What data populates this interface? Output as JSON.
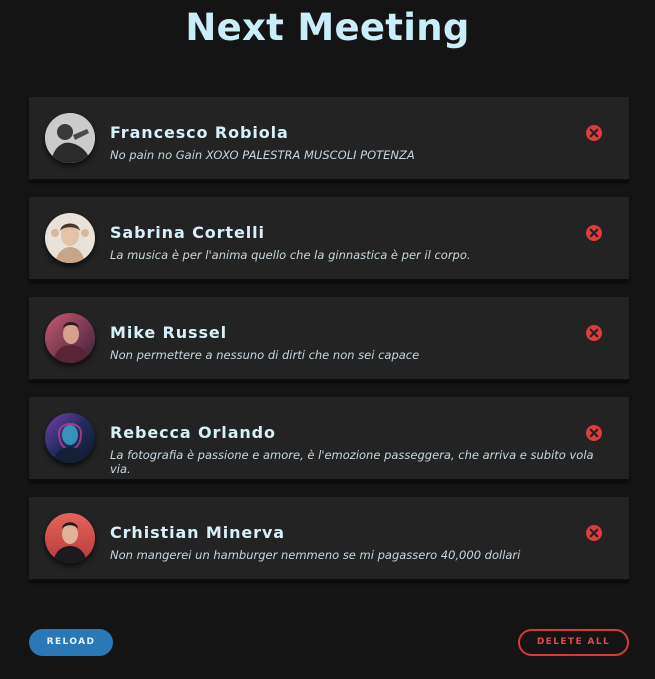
{
  "page": {
    "title": "Next Meeting"
  },
  "meetings": [
    {
      "name": "Francesco Robiola",
      "quote": "No pain no Gain XOXO PALESTRA MUSCOLI POTENZA",
      "avatar_icon": "person-photo-avatar"
    },
    {
      "name": "Sabrina Cortelli",
      "quote": "La musica è per l'anima quello che la ginnastica è per il corpo.",
      "avatar_icon": "person-photo-avatar"
    },
    {
      "name": "Mike Russel",
      "quote": "Non permettere a nessuno di dirti che non sei capace",
      "avatar_icon": "person-photo-avatar"
    },
    {
      "name": "Rebecca Orlando",
      "quote": "La fotografia è passione e amore, è l'emozione passeggera, che arriva e subito vola via.",
      "avatar_icon": "person-photo-avatar"
    },
    {
      "name": "Crhistian Minerva",
      "quote": "Non mangerei un hamburger nemmeno se mi pagassero 40,000 dollari",
      "avatar_icon": "person-photo-avatar"
    }
  ],
  "actions": {
    "reload_label": "RELOAD",
    "delete_all_label": "DELETE ALL"
  },
  "colors": {
    "background": "#141414",
    "card": "#232324",
    "title": "#c9eef9",
    "accent_blue": "#2b78b7",
    "danger_red": "#d63a3a"
  }
}
